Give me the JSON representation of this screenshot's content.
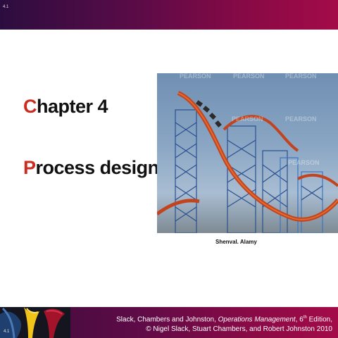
{
  "slide": {
    "number_top": "4.1",
    "number_bottom": "4.1"
  },
  "title": {
    "chapter_initial": "C",
    "chapter_rest": "hapter 4",
    "topic_initial": "P",
    "topic_rest": "rocess design"
  },
  "photo": {
    "watermark": "PEARSON",
    "caption": "Shenval. Alamy"
  },
  "footer": {
    "authors": "Slack, Chambers and Johnston, ",
    "book_title": "Operations Management",
    "edition_prefix": ", 6",
    "edition_sup": "th",
    "edition_suffix": " Edition,",
    "copyright": "© Nigel Slack, Stuart Chambers, and Robert Johnston 2010"
  },
  "colors": {
    "accent_initial": "#cc2b1f",
    "bar_dark": "#3b0c3a",
    "bar_bright": "#a30b48"
  }
}
